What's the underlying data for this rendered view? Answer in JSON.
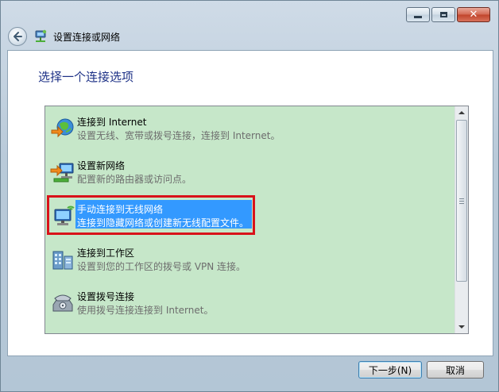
{
  "window": {
    "title": "设置连接或网络",
    "controls": {
      "close_glyph": "✕"
    }
  },
  "page": {
    "heading": "选择一个连接选项"
  },
  "options": [
    {
      "title": "连接到 Internet",
      "description": "设置无线、宽带或拨号连接，连接到 Internet。",
      "icon": "globe-internet-icon"
    },
    {
      "title": "设置新网络",
      "description": "配置新的路由器或访问点。",
      "icon": "new-network-icon"
    },
    {
      "title": "手动连接到无线网络",
      "description": "连接到隐藏网络或创建新无线配置文件。",
      "icon": "wireless-network-icon",
      "selected": true
    },
    {
      "title": "连接到工作区",
      "description": "设置到您的工作区的拨号或 VPN 连接。",
      "icon": "workplace-icon"
    },
    {
      "title": "设置拨号连接",
      "description": "使用拨号连接连接到 Internet。",
      "icon": "dialup-phone-icon"
    }
  ],
  "buttons": {
    "next": "下一步(N)",
    "cancel": "取消"
  },
  "colors": {
    "list_background": "#c6e7c9",
    "selection": "#3399ff",
    "highlight_box": "#d9121a",
    "heading": "#1e3287"
  }
}
